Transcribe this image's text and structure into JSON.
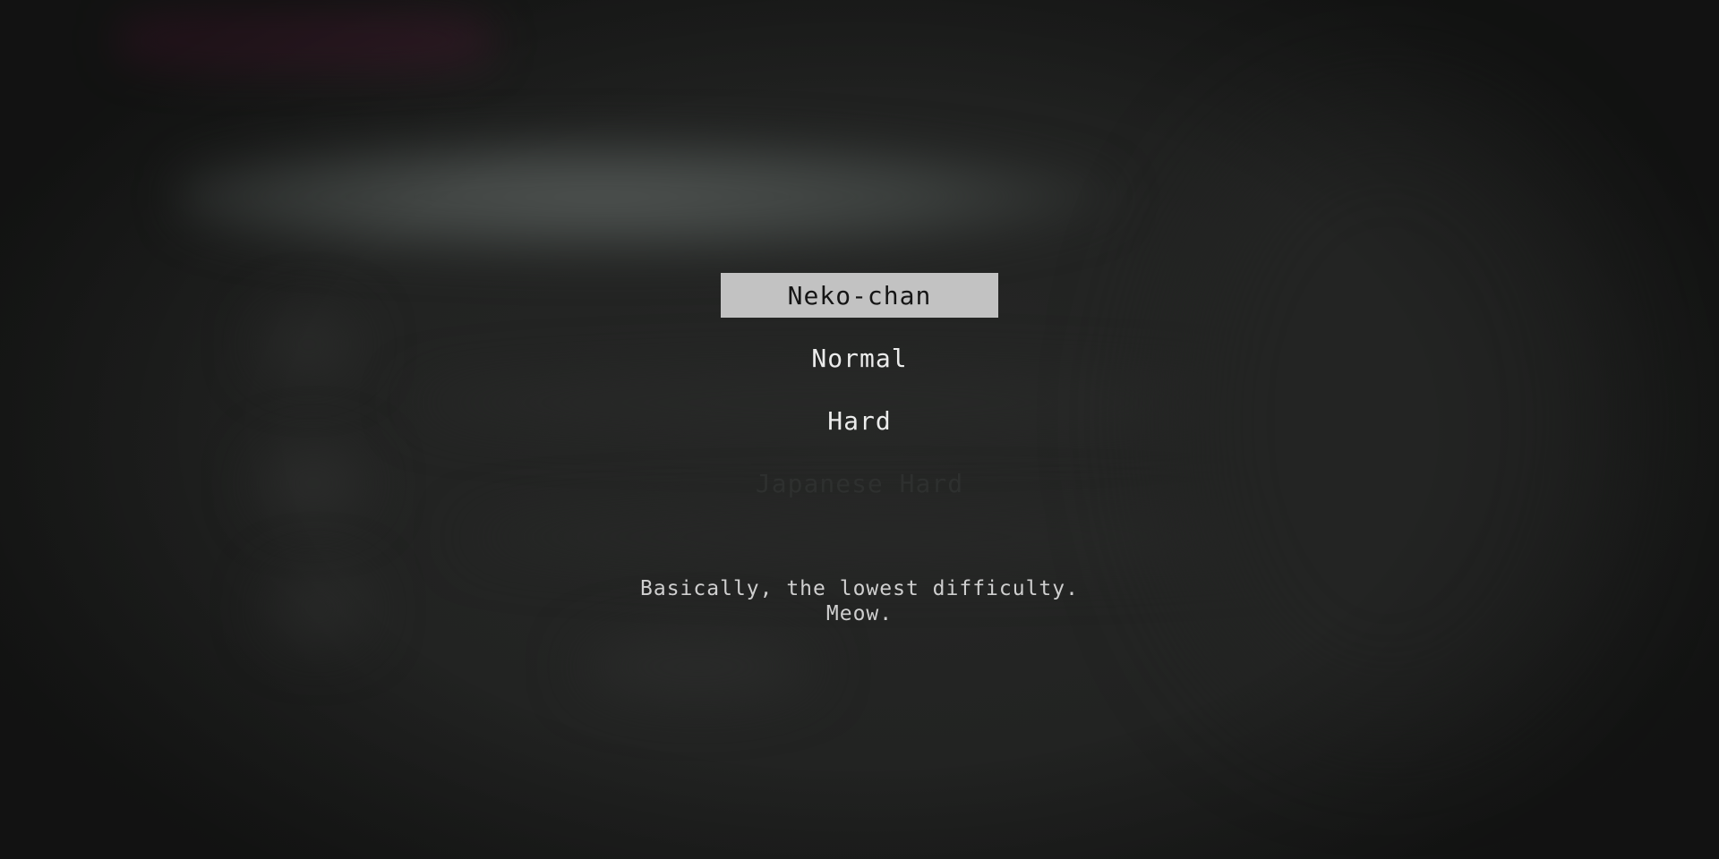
{
  "difficulty_menu": {
    "items": [
      {
        "label": "Neko-chan",
        "state": "selected"
      },
      {
        "label": "Normal",
        "state": "enabled"
      },
      {
        "label": "Hard",
        "state": "enabled"
      },
      {
        "label": "Japanese Hard",
        "state": "locked"
      }
    ]
  },
  "description": {
    "line1": "Basically, the lowest difficulty.",
    "line2": "Meow."
  },
  "colors": {
    "highlight_bg": "#c2c2c2",
    "highlight_text": "#151515",
    "menu_text": "#ececec",
    "locked_text": "#2e302f",
    "background": "#222322"
  }
}
